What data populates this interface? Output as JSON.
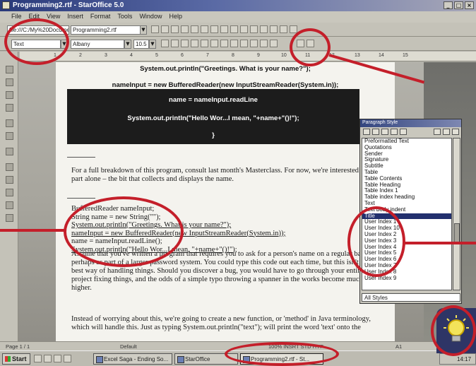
{
  "window": {
    "title": "Programming2.rtf - StarOffice 5.0",
    "controls": [
      "_",
      "□",
      "×"
    ]
  },
  "menu": [
    "File",
    "Edit",
    "View",
    "Insert",
    "Format",
    "Tools",
    "Window",
    "Help"
  ],
  "toolbar": {
    "url_value": "file:///C:/My%20Documents",
    "file_value": "Programming2.rtf",
    "style_value": "Text",
    "font_value": "Albany",
    "size_value": "10.5"
  },
  "ruler_ticks": [
    "1",
    "2",
    "3",
    "4",
    "5",
    "6",
    "7",
    "8",
    "9",
    "10",
    "11",
    "12",
    "13",
    "14",
    "15"
  ],
  "document": {
    "heading_line": "System.out.println(\"Greetings. What is your name?\");",
    "input_line": "nameInput = new BufferedReader(new InputStreamReader(System.in));",
    "box_lines": [
      "name = nameInput.readLine",
      "System.out.println(\"Hello Wor...I mean, \"+name+\"()!\");",
      "}"
    ],
    "para1": "For a full breakdown of this program, consult last month's Masterclass. For now, we're interested in this part alone – the bit that collects and displays the name.",
    "code_lines": [
      "BufferedReader nameInput;",
      "String name = new String(\"\");",
      "System.out.println(\"Greetings. What is your name?\");",
      "nameInput = new BufferedReader(new InputStreamReader(System.in));",
      "name = nameInput.readLine();",
      "System.out.println(\"Hello Wor...I mean, \"+name+\"()!\");"
    ],
    "para2": "Assume that you've written a program that requires you to ask for a person's name on a regular basis – perhaps as part of a larger password system. You could type this code out each time, but this isn't the best way of handling things. Should you discover a bug, you would have to go through your entire project fixing things, and the odds of a simple typo throwing a spanner in the works become much higher.",
    "para3": "Instead of worrying about this, we're going to create a new function, or 'method' in Java terminology, which will handle this. Just as typing System.out.println(\"text\"); will print the word 'text' onto the"
  },
  "paragraph_styles": {
    "title": "Paragraph Style",
    "items": [
      "Preformatted Text",
      "Quotations",
      "Sender",
      "Signature",
      "Subtitle",
      "Table",
      "Table Contents",
      "Table Heading",
      "Table Index 1",
      "Table index heading",
      "Text",
      "Text body indent",
      "Title",
      "User Index 1",
      "User Index 10",
      "User Index 2",
      "User Index 3",
      "User Index 4",
      "User Index 5",
      "User Index 6",
      "User Index 7",
      "User Index 8",
      "User Index 9"
    ],
    "selected_index": 12,
    "filter": "All Styles"
  },
  "status": {
    "page": "Page 1 / 1",
    "style": "Default",
    "modes": "100%  INSRT  STD  HYP",
    "lang": "A1"
  },
  "taskbar": {
    "start": "Start",
    "tasks": [
      "Excel Saga - Ending So...",
      "StarOffice",
      "Programming2.rtf - St..."
    ],
    "active_task": 2,
    "clock": "14:17"
  },
  "colors": {
    "callout": "#c41f2a",
    "selection": "#22306e",
    "code_box": "#1c1c1c"
  }
}
